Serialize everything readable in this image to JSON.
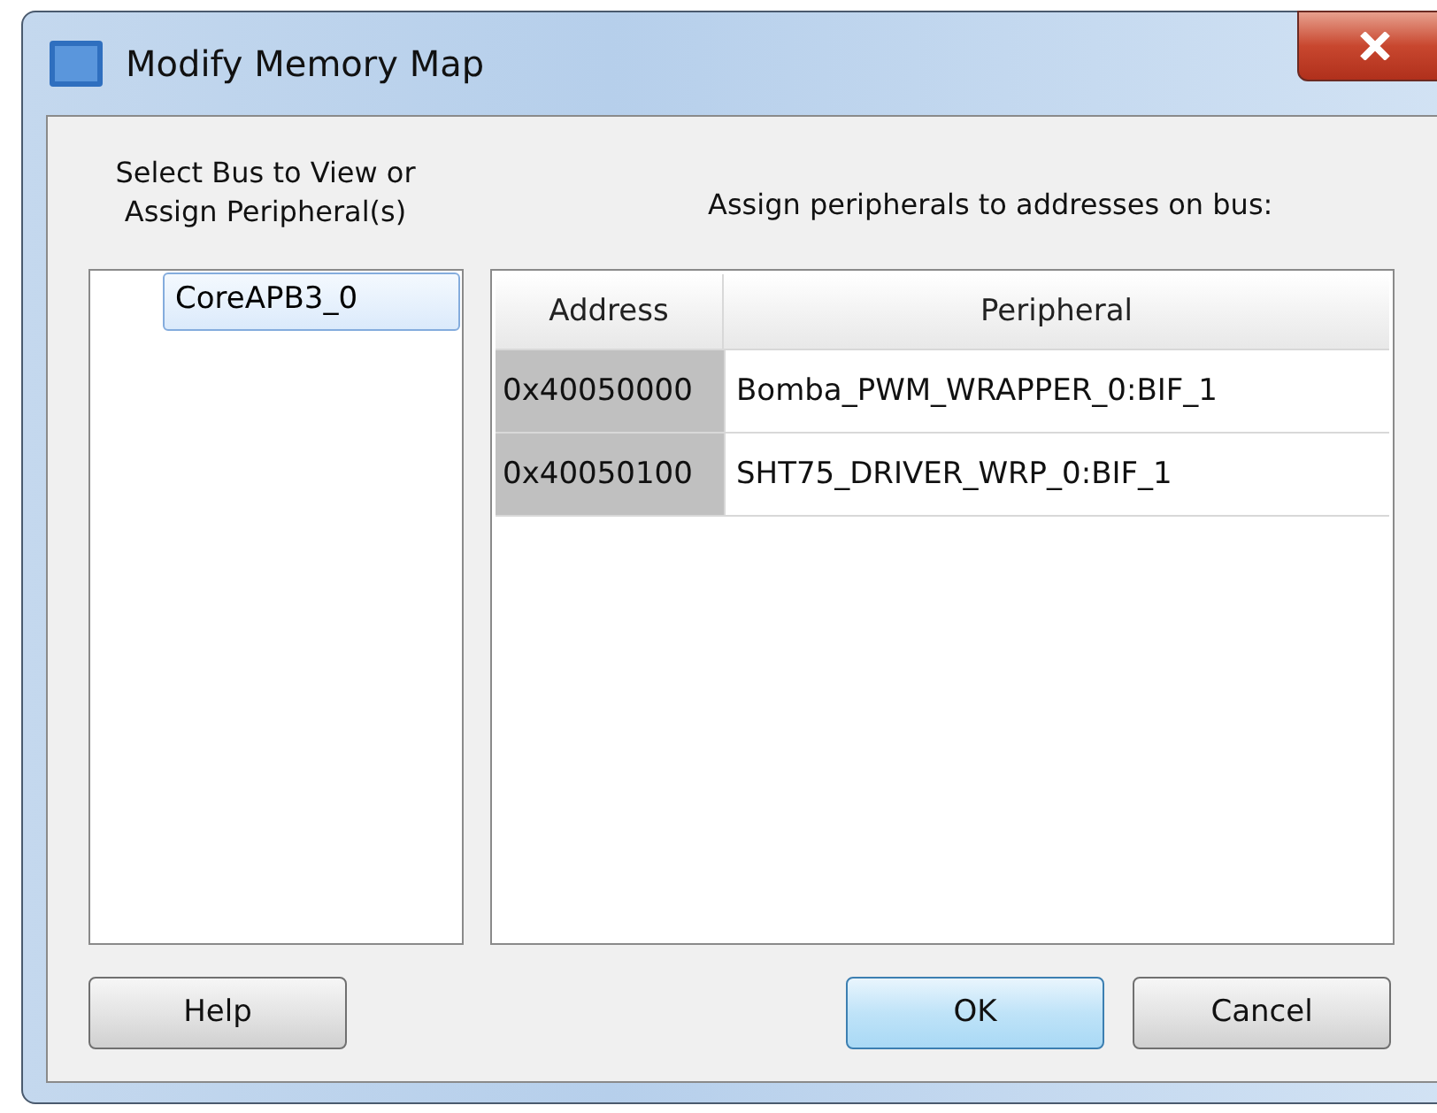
{
  "window": {
    "title": "Modify Memory Map"
  },
  "bus_panel": {
    "label": "Select Bus to View or Assign Peripheral(s)",
    "items": [
      {
        "label": "CoreAPB3_0",
        "selected": true
      }
    ]
  },
  "assign_panel": {
    "label": "Assign peripherals to addresses on bus:",
    "columns": [
      "Address",
      "Peripheral"
    ],
    "rows": [
      {
        "address": "0x40050000",
        "peripheral": "Bomba_PWM_WRAPPER_0:BIF_1"
      },
      {
        "address": "0x40050100",
        "peripheral": "SHT75_DRIVER_WRP_0:BIF_1"
      }
    ]
  },
  "buttons": [
    {
      "label": "Help",
      "default": false
    },
    {
      "label": "OK",
      "default": true
    },
    {
      "label": "Cancel",
      "default": false
    }
  ]
}
